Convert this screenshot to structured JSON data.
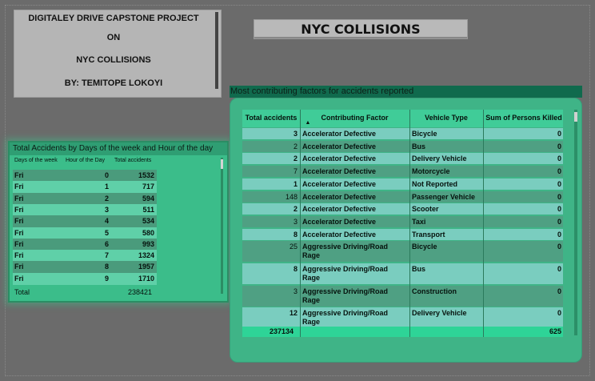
{
  "title_box": {
    "line1": "DIGITALEY DRIVE CAPSTONE PROJECT",
    "line2": "ON",
    "line3": "NYC  COLLISIONS",
    "line4": "BY: TEMITOPE LOKOYI"
  },
  "banner": {
    "text": "NYC COLLISIONS"
  },
  "left_table": {
    "title": "Total Accidents by Days of the week and Hour of the day",
    "columns": [
      "Days of the week",
      "Hour of the Day",
      "Total accidents"
    ],
    "rows": [
      [
        "Fri",
        "0",
        "1532"
      ],
      [
        "Fri",
        "1",
        "717"
      ],
      [
        "Fri",
        "2",
        "594"
      ],
      [
        "Fri",
        "3",
        "511"
      ],
      [
        "Fri",
        "4",
        "534"
      ],
      [
        "Fri",
        "5",
        "580"
      ],
      [
        "Fri",
        "6",
        "993"
      ],
      [
        "Fri",
        "7",
        "1324"
      ],
      [
        "Fri",
        "8",
        "1957"
      ],
      [
        "Fri",
        "9",
        "1710"
      ]
    ],
    "total_label": "Total",
    "total_value": "238421"
  },
  "right_table": {
    "title": "Most contributing factors for accidents reported",
    "columns": [
      "Total accidents",
      "Contributing Factor",
      "Vehicle Type",
      "Sum of Persons Killed"
    ],
    "sort_indicator": "▲",
    "rows": [
      [
        "3",
        "Accelerator Defective",
        "Bicycle",
        "0"
      ],
      [
        "2",
        "Accelerator Defective",
        "Bus",
        "0"
      ],
      [
        "2",
        "Accelerator Defective",
        "Delivery Vehicle",
        "0"
      ],
      [
        "7",
        "Accelerator Defective",
        "Motorcycle",
        "0"
      ],
      [
        "1",
        "Accelerator Defective",
        "Not Reported",
        "0"
      ],
      [
        "148",
        "Accelerator Defective",
        "Passenger Vehicle",
        "0"
      ],
      [
        "2",
        "Accelerator Defective",
        "Scooter",
        "0"
      ],
      [
        "3",
        "Accelerator Defective",
        "Taxi",
        "0"
      ],
      [
        "8",
        "Accelerator Defective",
        "Transport",
        "0"
      ],
      [
        "25",
        "Aggressive Driving/Road Rage",
        "Bicycle",
        "0"
      ],
      [
        "8",
        "Aggressive Driving/Road Rage",
        "Bus",
        "0"
      ],
      [
        "3",
        "Aggressive Driving/Road Rage",
        "Construction",
        "0"
      ],
      [
        "12",
        "Aggressive Driving/Road Rage",
        "Delivery Vehicle",
        "0"
      ]
    ],
    "total_accidents": "237134",
    "total_killed": "625"
  },
  "colors": {
    "background": "#6b6b6b",
    "table_green": "#3bbd8a",
    "row_light": "#5fd0a8",
    "row_dark": "#4a9b7c",
    "header_dark": "#106a4d"
  }
}
